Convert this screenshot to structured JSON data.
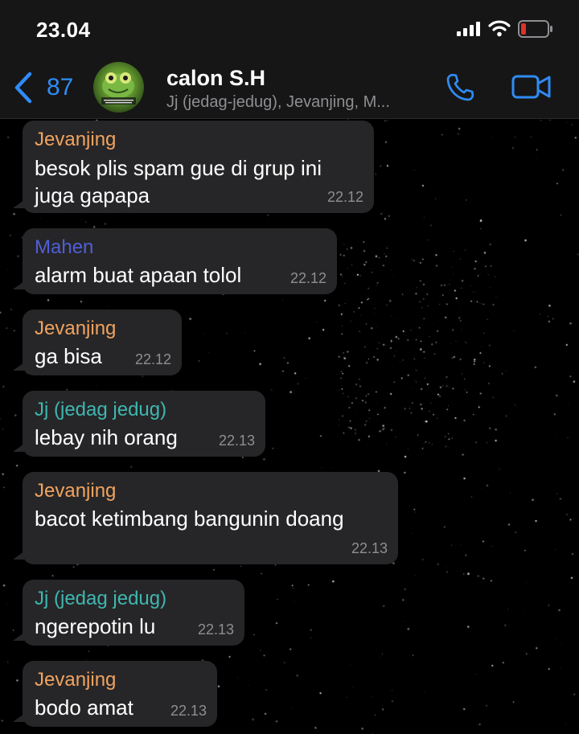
{
  "status_bar": {
    "time": "23.04"
  },
  "header": {
    "back_count": "87",
    "title": "calon S.H",
    "subtitle": "Jj (jedag-jedug), Jevanjing, M...",
    "accent_color": "#2f8cf6",
    "icons": [
      "chevron-left-icon",
      "phone-icon",
      "video-camera-icon"
    ]
  },
  "messages": [
    {
      "sender": "Jevanjing",
      "sender_color": "#f2a35f",
      "lines": [
        "besok plis spam gue di grup ini",
        "juga gapapa"
      ],
      "time": "22.12"
    },
    {
      "sender": "Mahen",
      "sender_color": "#4f5fd8",
      "lines": [
        "alarm buat apaan tolol"
      ],
      "time": "22.12"
    },
    {
      "sender": "Jevanjing",
      "sender_color": "#f2a35f",
      "lines": [
        "ga bisa"
      ],
      "time": "22.12"
    },
    {
      "sender": "Jj (jedag jedug)",
      "sender_color": "#3fb7b0",
      "lines": [
        "lebay nih orang"
      ],
      "time": "22.13"
    },
    {
      "sender": "Jevanjing",
      "sender_color": "#f2a35f",
      "lines": [
        "bacot ketimbang bangunin doang"
      ],
      "time": "22.13"
    },
    {
      "sender": "Jj (jedag jedug)",
      "sender_color": "#3fb7b0",
      "lines": [
        "ngerepotin lu"
      ],
      "time": "22.13"
    },
    {
      "sender": "Jevanjing",
      "sender_color": "#f2a35f",
      "lines": [
        "bodo amat"
      ],
      "time": "22.13"
    }
  ]
}
